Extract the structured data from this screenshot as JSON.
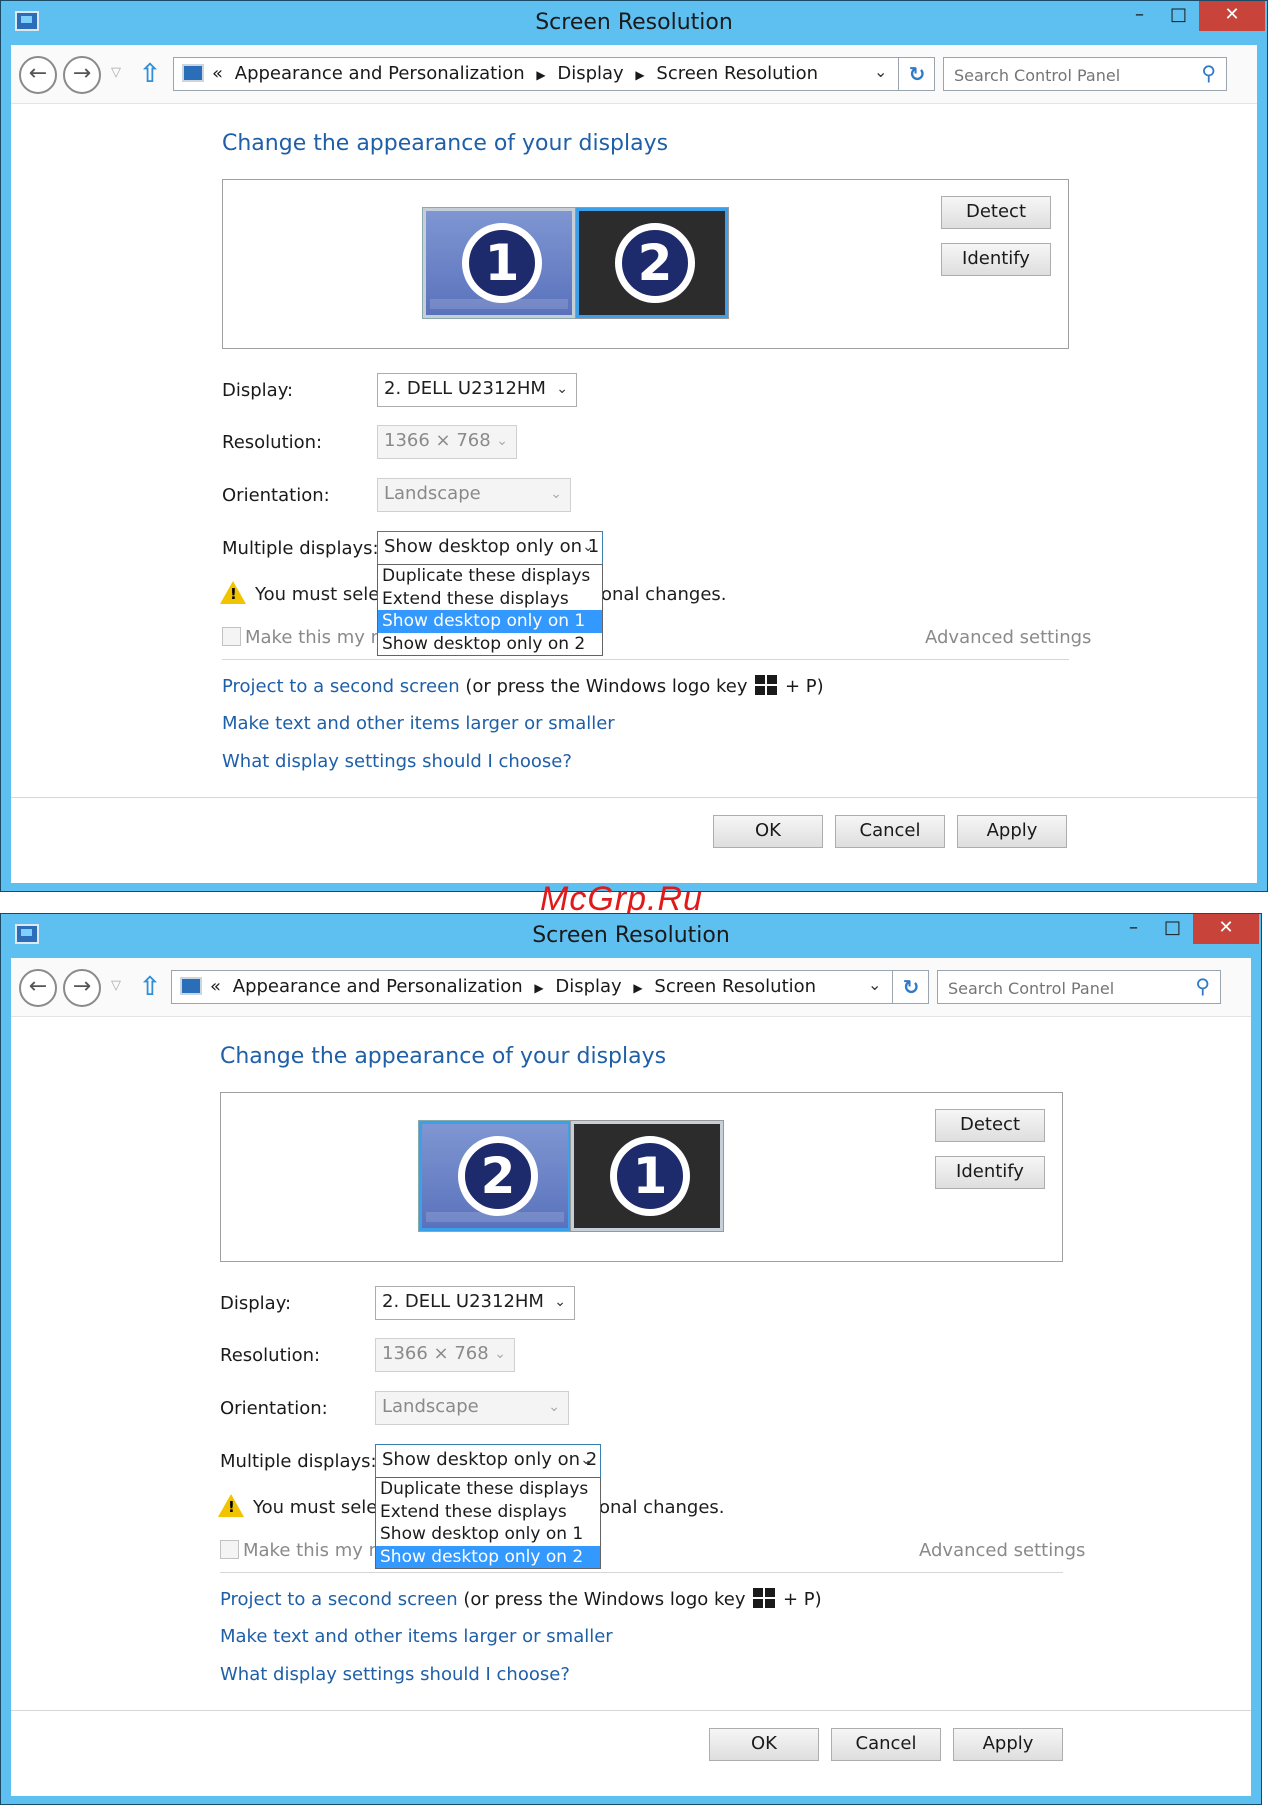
{
  "watermark": "McGrp.Ru",
  "windows": [
    {
      "title": "Screen Resolution",
      "breadcrumb": {
        "prefix": "«",
        "items": [
          "Appearance and Personalization",
          "Display",
          "Screen Resolution"
        ]
      },
      "search_placeholder": "Search Control Panel",
      "heading": "Change the appearance of your displays",
      "monitor_left_number": "1",
      "monitor_right_number": "2",
      "detect_label": "Detect",
      "identify_label": "Identify",
      "display_label": "Display:",
      "display_value": "2. DELL U2312HM",
      "resolution_label": "Resolution:",
      "resolution_value": "1366 × 768",
      "orientation_label": "Orientation:",
      "orientation_value": "Landscape",
      "multiple_label": "Multiple displays:",
      "multiple_value": "Show desktop only on 1",
      "dropdown_options": [
        "Duplicate these displays",
        "Extend these displays",
        "Show desktop only on 1",
        "Show desktop only on 2"
      ],
      "selected_option_index": 2,
      "warning_left": "You must select",
      "warning_right": "onal changes.",
      "checkbox_label": "Make this my ma",
      "advanced_settings": "Advanced settings",
      "project_link": "Project to a second screen",
      "project_note_a": "(or press the Windows logo key",
      "project_note_b": "+ P)",
      "text_size_link": "Make text and other items larger or smaller",
      "help_link": "What display settings should I choose?",
      "ok_label": "OK",
      "cancel_label": "Cancel",
      "apply_label": "Apply"
    },
    {
      "title": "Screen Resolution",
      "breadcrumb": {
        "prefix": "«",
        "items": [
          "Appearance and Personalization",
          "Display",
          "Screen Resolution"
        ]
      },
      "search_placeholder": "Search Control Panel",
      "heading": "Change the appearance of your displays",
      "monitor_left_number": "2",
      "monitor_right_number": "1",
      "detect_label": "Detect",
      "identify_label": "Identify",
      "display_label": "Display:",
      "display_value": "2. DELL U2312HM",
      "resolution_label": "Resolution:",
      "resolution_value": "1366 × 768",
      "orientation_label": "Orientation:",
      "orientation_value": "Landscape",
      "multiple_label": "Multiple displays:",
      "multiple_value": "Show desktop only on 2",
      "dropdown_options": [
        "Duplicate these displays",
        "Extend these displays",
        "Show desktop only on 1",
        "Show desktop only on 2"
      ],
      "selected_option_index": 3,
      "warning_left": "You must select",
      "warning_right": "onal changes.",
      "checkbox_label": "Make this my ma",
      "advanced_settings": "Advanced settings",
      "project_link": "Project to a second screen",
      "project_note_a": "(or press the Windows logo key",
      "project_note_b": "+ P)",
      "text_size_link": "Make text and other items larger or smaller",
      "help_link": "What display settings should I choose?",
      "ok_label": "OK",
      "cancel_label": "Cancel",
      "apply_label": "Apply"
    }
  ]
}
